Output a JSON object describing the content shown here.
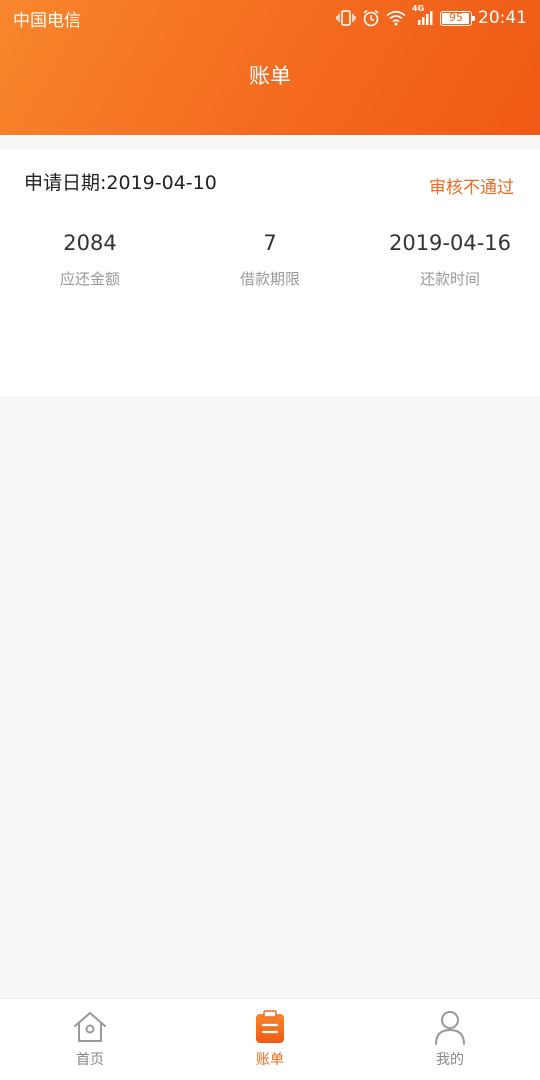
{
  "status_bar": {
    "carrier": "中国电信",
    "network": "4G",
    "battery": "95",
    "time": "20:41"
  },
  "header": {
    "title": "账单"
  },
  "bill": {
    "apply_date": "申请日期:2019-04-10",
    "status": "审核不通过",
    "stats": [
      {
        "value": "2084",
        "label": "应还金额"
      },
      {
        "value": "7",
        "label": "借款期限"
      },
      {
        "value": "2019-04-16",
        "label": "还款时间"
      }
    ]
  },
  "tabbar": {
    "items": [
      {
        "label": "首页",
        "icon": "home-icon",
        "active": false
      },
      {
        "label": "账单",
        "icon": "bill-icon",
        "active": true
      },
      {
        "label": "我的",
        "icon": "user-icon",
        "active": false
      }
    ]
  },
  "colors": {
    "accent": "#ef6a21",
    "header_start": "#f8862c",
    "header_end": "#ef5a15"
  }
}
